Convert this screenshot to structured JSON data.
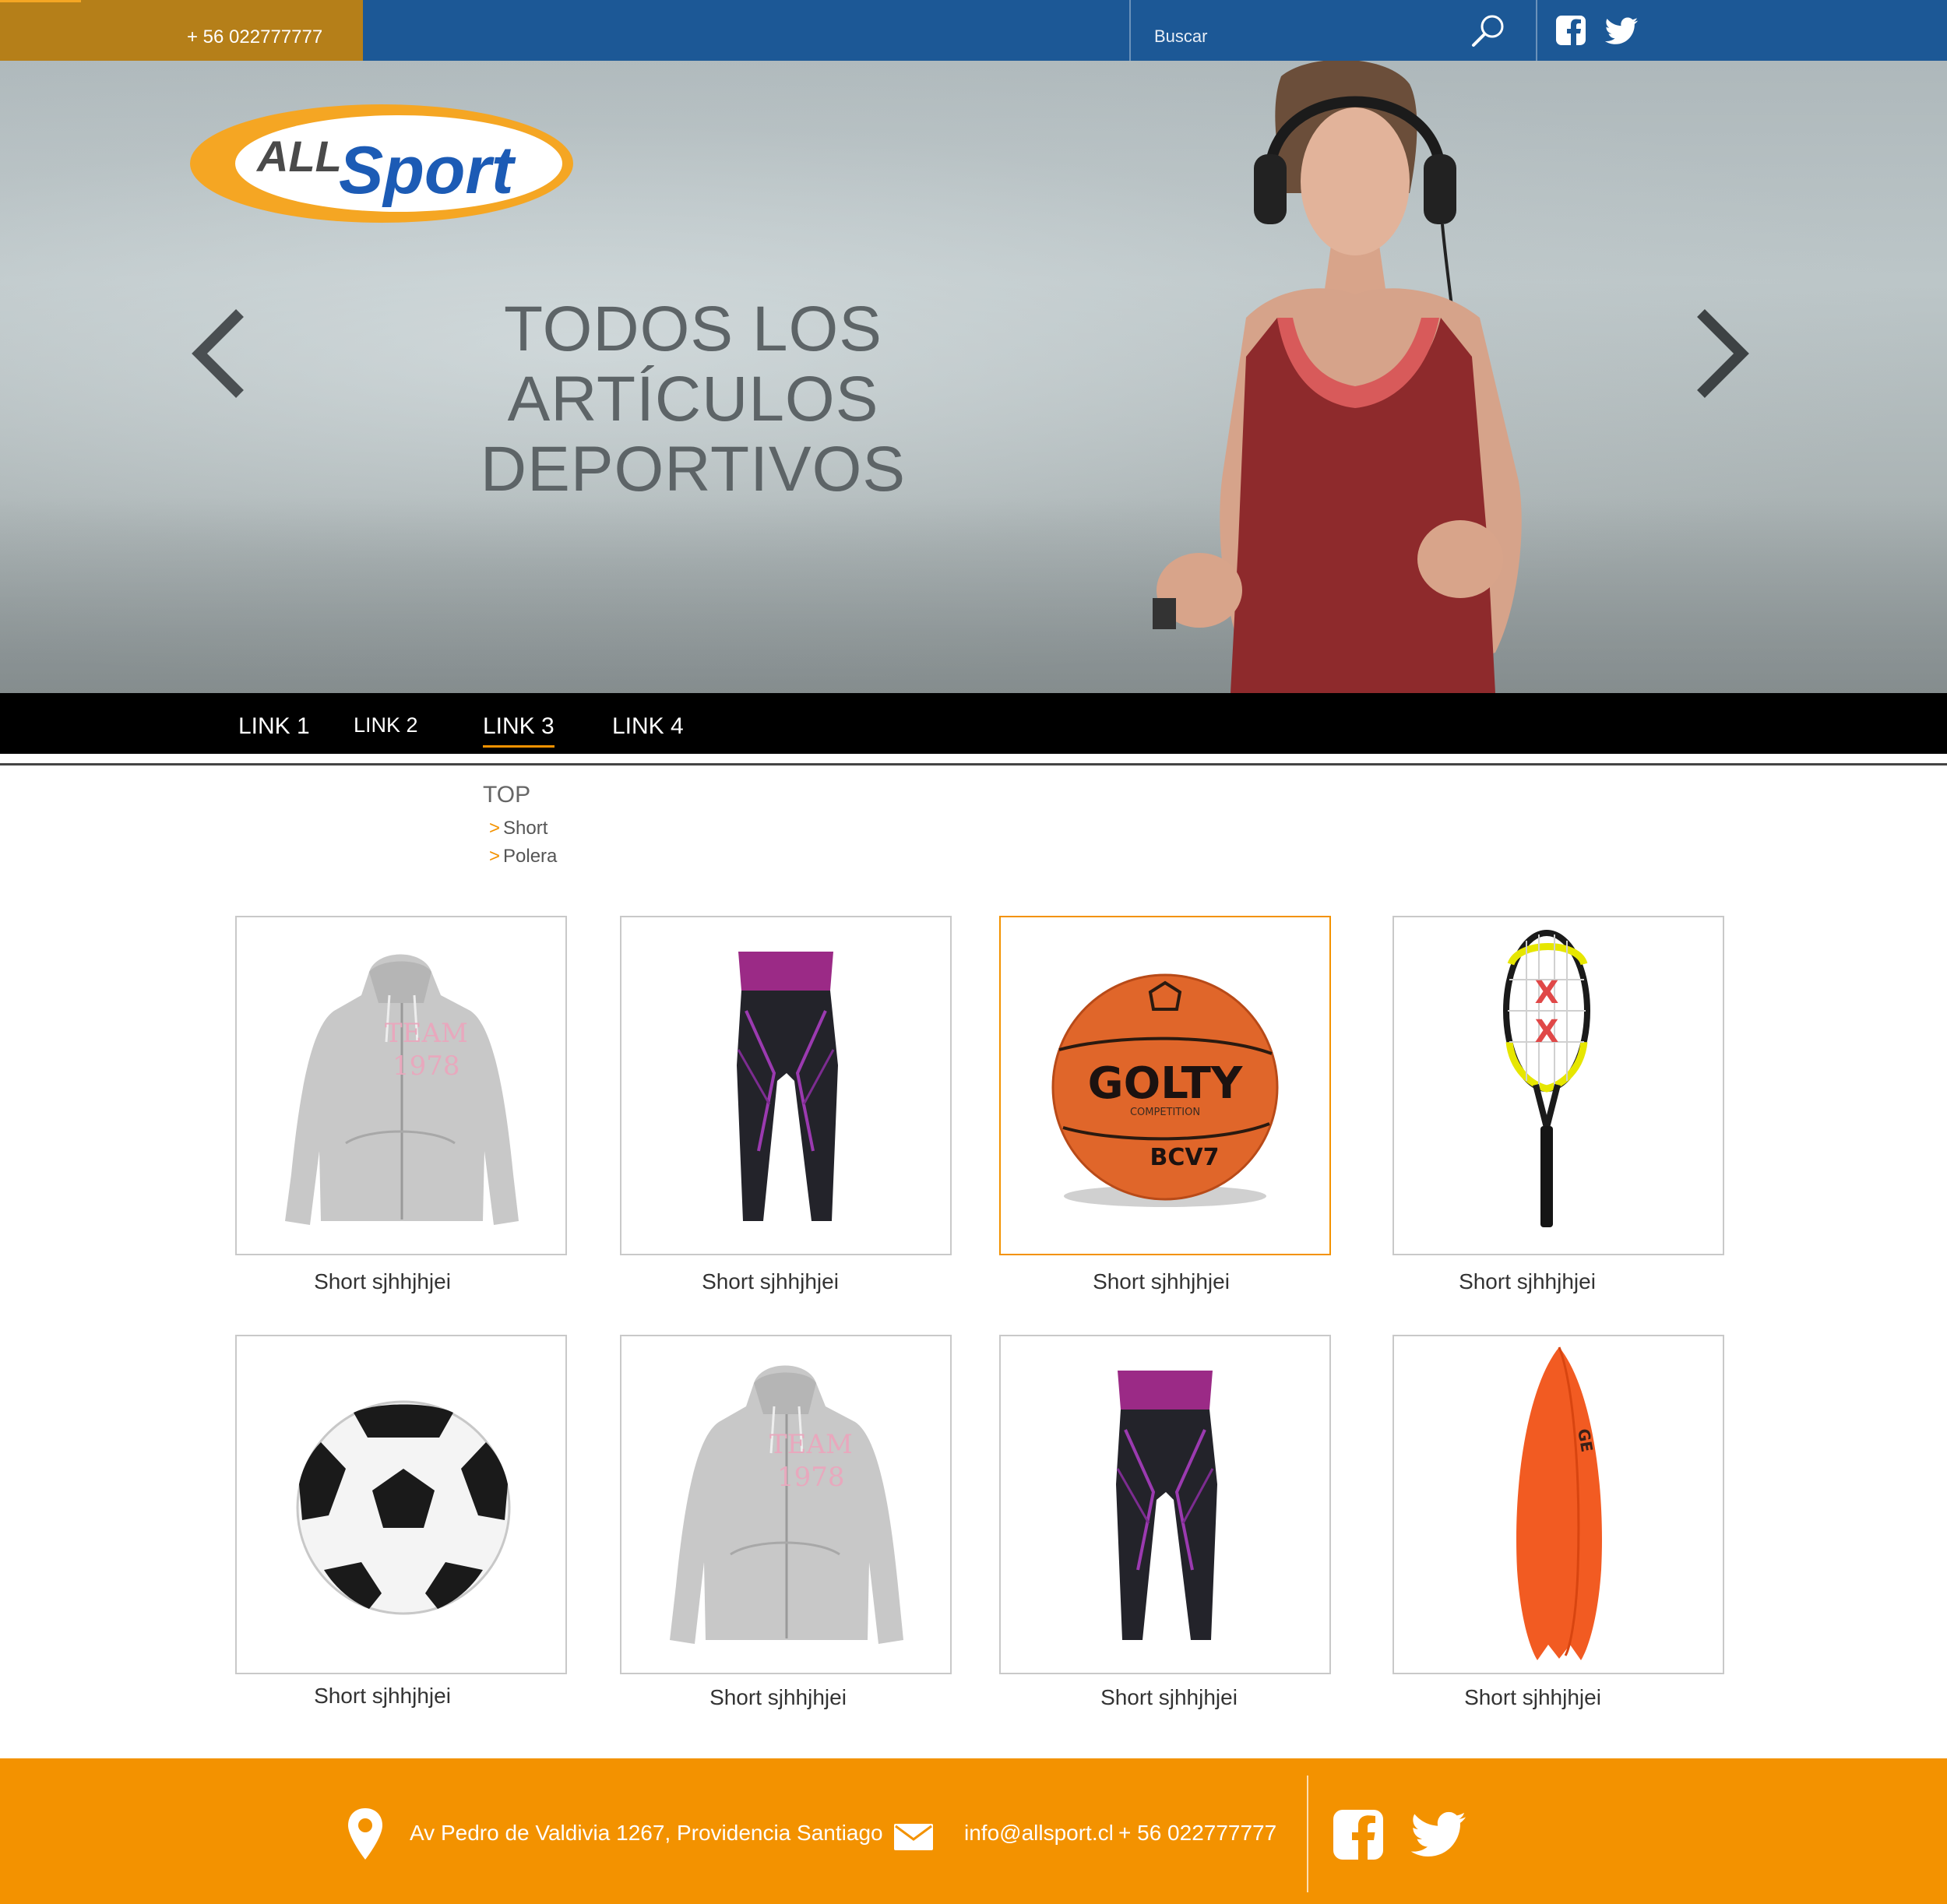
{
  "topbar": {
    "phone": "+ 56 022777777",
    "search_placeholder": "Buscar"
  },
  "hero": {
    "logo_text_1": "ALL",
    "logo_text_2": "Sport",
    "title_line_1": "TODOS LOS ARTÍCULOS",
    "title_line_2": "DEPORTIVOS"
  },
  "nav": {
    "items": [
      {
        "label": "LINK 1"
      },
      {
        "label": "LINK 2"
      },
      {
        "label": "LINK 3"
      },
      {
        "label": "LINK 4"
      }
    ],
    "active_index": 2
  },
  "category": {
    "title": "TOP",
    "items": [
      "Short",
      "Polera"
    ]
  },
  "products": [
    {
      "label": "Short sjhhjhjei",
      "image": "hoodie"
    },
    {
      "label": "Short sjhhjhjei",
      "image": "leggings"
    },
    {
      "label": "Short sjhhjhjei",
      "image": "basketball",
      "selected": true,
      "ball_text": "GOLTY",
      "ball_subtext": "COMPETITION",
      "ball_model": "BCV7"
    },
    {
      "label": "Short sjhhjhjei",
      "image": "tennis-racket"
    },
    {
      "label": "Short sjhhjhjei",
      "image": "soccer-ball"
    },
    {
      "label": "Short sjhhjhjei",
      "image": "hoodie"
    },
    {
      "label": "Short sjhhjhjei",
      "image": "leggings"
    },
    {
      "label": "Short sjhhjhjei",
      "image": "surfboard"
    }
  ],
  "footer": {
    "address": "Av Pedro de Valdivia 1267, Providencia Santiago",
    "email": "info@allsport.cl",
    "phone": "+ 56 022777777"
  },
  "colors": {
    "topbar_blue": "#1c5896",
    "phone_gold": "#b57f19",
    "accent_orange": "#f39200",
    "nav_black": "#000000"
  },
  "icons": [
    "search-icon",
    "facebook-icon",
    "twitter-icon",
    "chevron-left-icon",
    "chevron-right-icon",
    "location-pin-icon",
    "mail-icon"
  ]
}
